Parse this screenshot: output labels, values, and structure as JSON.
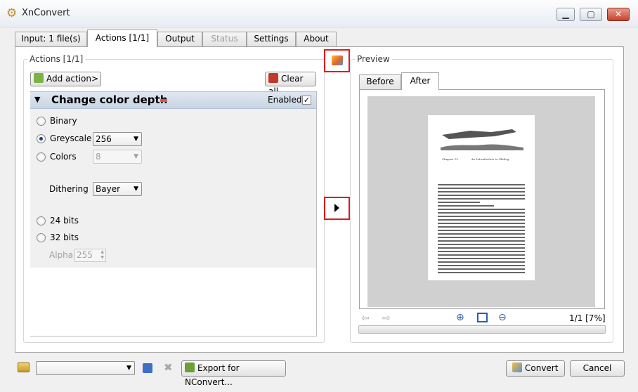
{
  "window": {
    "title": "XnConvert",
    "min_symbol": "▁",
    "max_symbol": "▢",
    "close_symbol": "✕"
  },
  "tabs": [
    {
      "label": "Input: 1 file(s)"
    },
    {
      "label": "Actions [1/1]"
    },
    {
      "label": "Output"
    },
    {
      "label": "Status"
    },
    {
      "label": "Settings"
    },
    {
      "label": "About"
    }
  ],
  "actions": {
    "group_title": "Actions [1/1]",
    "add_action_label": "Add action>",
    "clear_all_label": "Clear all",
    "item": {
      "title": "Change color depth",
      "enabled_label": "Enabled",
      "enabled": true,
      "options": {
        "binary": "Binary",
        "greyscale": "Greyscale",
        "greyscale_value": "256",
        "colors": "Colors",
        "colors_value": "8",
        "dithering": "Dithering",
        "dithering_value": "Bayer",
        "bits24": "24 bits",
        "bits32": "32 bits",
        "alpha": "Alpha",
        "alpha_value": "255"
      },
      "selected": "greyscale"
    }
  },
  "preview": {
    "group_title": "Preview",
    "tab_before": "Before",
    "tab_after": "After",
    "active_tab": "After",
    "page_info": "1/1 [7%]",
    "page_heading_left": "Chapter 13",
    "page_heading_right": "An Introduction to Gliding"
  },
  "bottom": {
    "preset_value": "",
    "export_label": "Export for NConvert...",
    "convert_label": "Convert",
    "cancel_label": "Cancel"
  },
  "colors": {
    "accent_header": "#c9d5e4",
    "highlight_red": "#e01b1b"
  }
}
